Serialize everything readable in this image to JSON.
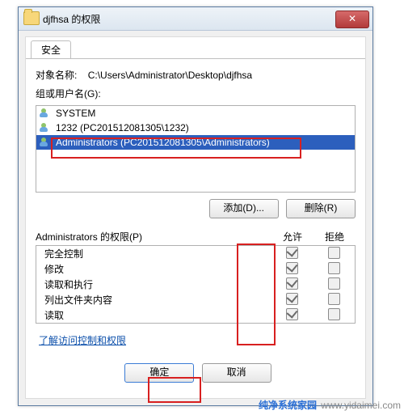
{
  "titlebar": {
    "title": "djfhsa 的权限",
    "close_glyph": "✕"
  },
  "tab": {
    "label": "安全"
  },
  "object": {
    "label": "对象名称:",
    "value": "C:\\Users\\Administrator\\Desktop\\djfhsa"
  },
  "groups": {
    "label": "组或用户名(G):",
    "items": [
      {
        "name": "SYSTEM"
      },
      {
        "name": "1232 (PC201512081305\\1232)"
      },
      {
        "name": "Administrators (PC201512081305\\Administrators)"
      }
    ],
    "selected_index": 2
  },
  "buttons": {
    "add": "添加(D)...",
    "remove": "删除(R)"
  },
  "permblock": {
    "label": "Administrators 的权限(P)",
    "allow_header": "允许",
    "deny_header": "拒绝",
    "rows": [
      {
        "name": "完全控制",
        "allow": true,
        "deny": false
      },
      {
        "name": "修改",
        "allow": true,
        "deny": false
      },
      {
        "name": "读取和执行",
        "allow": true,
        "deny": false
      },
      {
        "name": "列出文件夹内容",
        "allow": true,
        "deny": false
      },
      {
        "name": "读取",
        "allow": true,
        "deny": false
      }
    ]
  },
  "link": {
    "label": "了解访问控制和权限"
  },
  "dlg": {
    "ok": "确定",
    "cancel": "取消"
  },
  "footer": {
    "site": "纯净系统家园",
    "url": "www.yidaimei.com"
  }
}
